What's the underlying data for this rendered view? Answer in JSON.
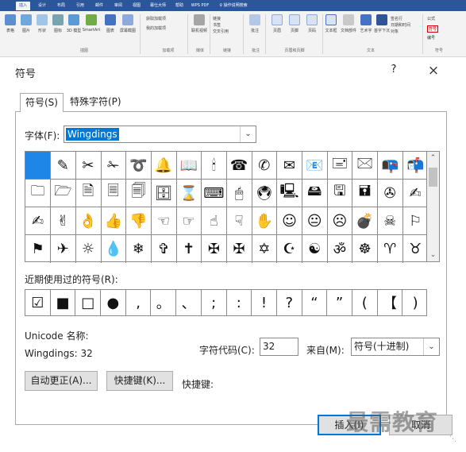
{
  "ribbon": {
    "tabs": [
      "插入",
      "设计",
      "布局",
      "引用",
      "邮件",
      "审阅",
      "视图",
      "幕仕大师",
      "帮助",
      "WPS PDF",
      "♀ 操作说明搜索"
    ],
    "active_tab_index": 0,
    "items": [
      "表格",
      "图片",
      "形状",
      "图标",
      "3D 模型",
      "SmartArt",
      "图表",
      "屏幕截图",
      "获取加载项",
      "我的加载项",
      "联机视频",
      "链接",
      "书签",
      "交叉引用",
      "批注",
      "页眉",
      "页脚",
      "页码",
      "文本框",
      "文档部件",
      "艺术字",
      "首字下沉",
      "签名行",
      "日期和时间",
      "对象",
      "公式",
      "符号",
      "编号"
    ],
    "groups": [
      "表格",
      "插图",
      "加载项",
      "媒体",
      "链接",
      "批注",
      "页眉和页脚",
      "文本",
      "符号"
    ]
  },
  "dialog": {
    "title": "符号",
    "help": "?",
    "close": "×",
    "tabs": [
      "符号(S)",
      "特殊字符(P)"
    ],
    "font_label": "字体(F):",
    "font_value": "Wingdings",
    "recent_label": "近期使用过的符号(R):",
    "unicode_name_label": "Unicode 名称:",
    "unicode_name_value": "Wingdings: 32",
    "char_code_label": "字符代码(C):",
    "char_code_value": "32",
    "from_label": "来自(M):",
    "from_value": "符号(十进制)",
    "autocorrect_button": "自动更正(A)...",
    "shortkey_button": "快捷键(K)...",
    "shortkey_label": "快捷键:",
    "insert_button": "插入(I)",
    "cancel_button": "取消"
  },
  "symbol_grid": {
    "rows": [
      [
        "",
        "✎",
        "✂",
        "✁",
        "➰",
        "🔔",
        "📖",
        "🕯",
        "☎",
        "✆",
        "✉",
        "📧",
        "🖃",
        "🖂",
        "📭",
        "📬"
      ],
      [
        "🗀",
        "🗁",
        "🗎",
        "🗏",
        "🗐",
        "🗄",
        "⌛",
        "⌨",
        "🖱",
        "🖲",
        "🖳",
        "🖴",
        "🖫",
        "🖬",
        "✇",
        "✍"
      ],
      [
        "✍",
        "✌",
        "👌",
        "👍",
        "👎",
        "☜",
        "☞",
        "☝",
        "☟",
        "✋",
        "☺",
        "😐",
        "☹",
        "💣",
        "☠",
        "⚐"
      ],
      [
        "⚑",
        "✈",
        "☼",
        "💧",
        "❄",
        "✞",
        "✝",
        "✠",
        "✠",
        "✡",
        "☪",
        "☯",
        "ॐ",
        "☸",
        "♈",
        "♉"
      ]
    ],
    "selected": {
      "row": 0,
      "col": 0
    }
  },
  "recent_symbols": [
    "☑",
    "■",
    "□",
    "●",
    ",",
    "。",
    "、",
    ";",
    ":",
    "!",
    "?",
    "“",
    "”",
    "(",
    "【",
    ")"
  ],
  "watermark": "最需教育"
}
